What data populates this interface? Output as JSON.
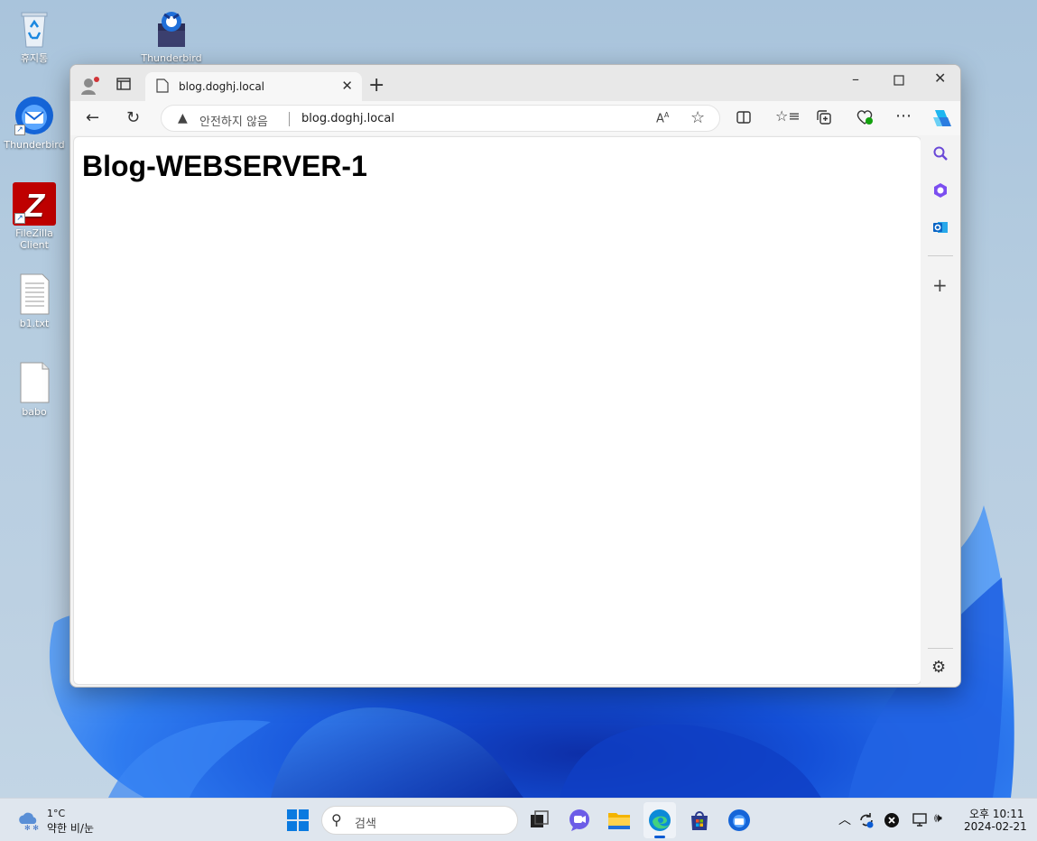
{
  "desktop": {
    "icons": [
      {
        "label": "휴지통"
      },
      {
        "label": "Thunderbird"
      },
      {
        "label": "Thunderbird"
      },
      {
        "label": "FileZilla\nClient"
      },
      {
        "label": "b1.txt"
      },
      {
        "label": "babo"
      }
    ]
  },
  "browser": {
    "tab_title": "blog.doghj.local",
    "security_text": "안전하지 않음",
    "url": "blog.doghj.local",
    "page_heading": "Blog-WEBSERVER-1"
  },
  "taskbar": {
    "weather_temp": "1°C",
    "weather_desc": "약한 비/눈",
    "search_placeholder": "검색",
    "time": "오후 10:11",
    "date": "2024-02-21"
  },
  "colors": {
    "accent": "#0a5bd3",
    "wallpaper_bloom": "#1450d8"
  }
}
